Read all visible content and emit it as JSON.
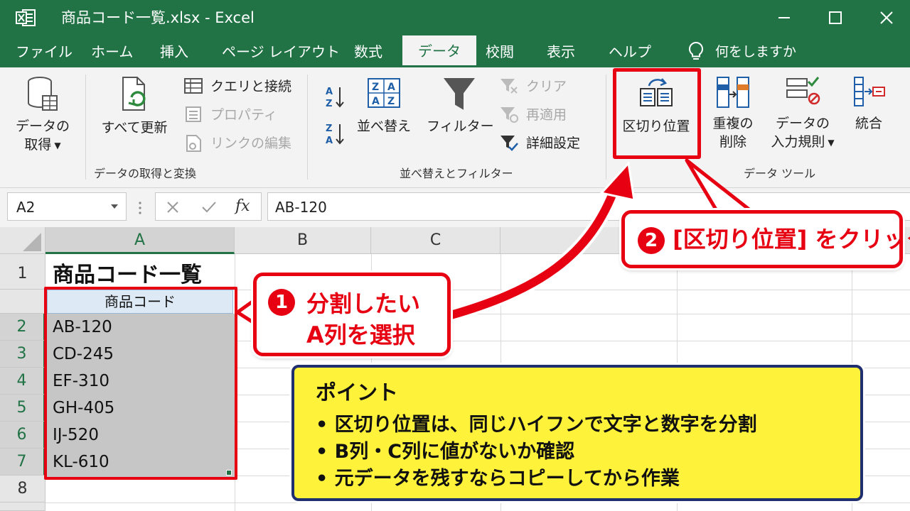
{
  "window": {
    "title": "商品コード一覧.xlsx  -  Excel"
  },
  "menu": {
    "tabs": [
      "ファイル",
      "ホーム",
      "挿入",
      "ページ レイアウト",
      "数式",
      "データ",
      "校閲",
      "表示",
      "ヘルプ"
    ],
    "active_tab": "データ",
    "tell_me": "何をしますか"
  },
  "ribbon": {
    "get_data": {
      "label_line1": "データの",
      "label_line2": "取得",
      "refresh_all": "すべて更新",
      "queries": "クエリと接続",
      "properties": "プロパティ",
      "edit_links": "リンクの編集",
      "group_label": "データの取得と変換"
    },
    "sort_filter": {
      "sort": "並べ替え",
      "filter": "フィルター",
      "clear": "クリア",
      "reapply": "再適用",
      "advanced": "詳細設定",
      "group_label": "並べ替えとフィルター"
    },
    "data_tools": {
      "text_to_columns": "区切り位置",
      "remove_dup_line1": "重複の",
      "remove_dup_line2": "削除",
      "validation_line1": "データの",
      "validation_line2": "入力規則",
      "consolidate": "統合",
      "group_label": "データ ツール"
    }
  },
  "formula_bar": {
    "name_box": "A2",
    "fx": "fx",
    "content": "AB-120"
  },
  "sheet": {
    "columns": [
      "A",
      "B",
      "C"
    ],
    "rows": [
      "1",
      "2",
      "3",
      "4",
      "5",
      "6",
      "7",
      "8"
    ],
    "title": "商品コード一覧",
    "header": "商品コード",
    "codes": [
      "AB-120",
      "CD-245",
      "EF-310",
      "GH-405",
      "IJ-520",
      "KL-610"
    ]
  },
  "annotations": {
    "step1_num": "1",
    "step1_line1": "分割したい",
    "step1_line2": "A列を選択",
    "step2_num": "2",
    "step2_text": "[区切り位置] をクリック",
    "point_title": "ポイント",
    "point_items": [
      "区切り位置は、同じハイフンで文字と数字を分割",
      "B列・C列に値がないか確認",
      "元データを残すならコピーしてから作業"
    ]
  },
  "colors": {
    "excel_green": "#217346",
    "highlight_red": "#e60012",
    "point_yellow": "#fff23a",
    "point_border": "#1f2f6f"
  }
}
